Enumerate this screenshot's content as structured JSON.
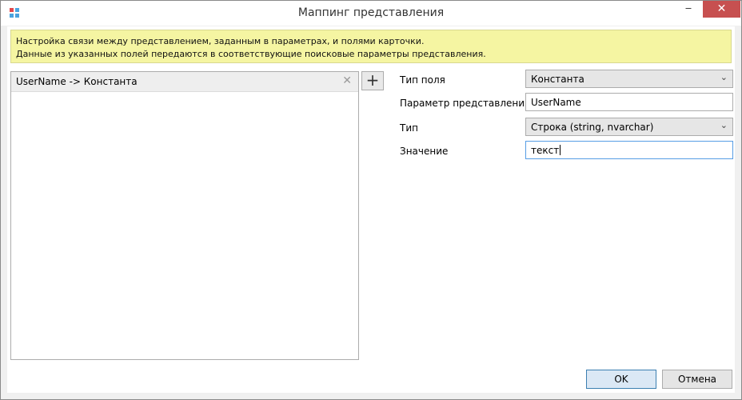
{
  "window": {
    "title": "Маппинг представления",
    "minimize_glyph": "‒",
    "maximize_glyph": "☐",
    "close_glyph": "✕",
    "app_icon_colors": [
      "#e2474b",
      "#4aa3df",
      "#4aa3df",
      "#4aa3df"
    ]
  },
  "info_banner": {
    "line1": "Настройка связи между представлением, заданным в параметрах, и полями карточки.",
    "line2": "Данные из указанных полей передаются в соответствующие поисковые параметры представления."
  },
  "mappings": {
    "items": [
      {
        "label": "UserName -> Константа"
      }
    ],
    "remove_glyph": "✕",
    "add_glyph": "+"
  },
  "form": {
    "field_type_label": "Тип поля",
    "field_type_value": "Константа",
    "view_param_label": "Параметр представления",
    "view_param_value": "UserName",
    "type_label": "Тип",
    "type_value": "Строка (string, nvarchar)",
    "value_label": "Значение",
    "value_value": "текст",
    "chevron_glyph": "⌄"
  },
  "footer": {
    "ok_label": "OK",
    "cancel_label": "Отмена"
  }
}
